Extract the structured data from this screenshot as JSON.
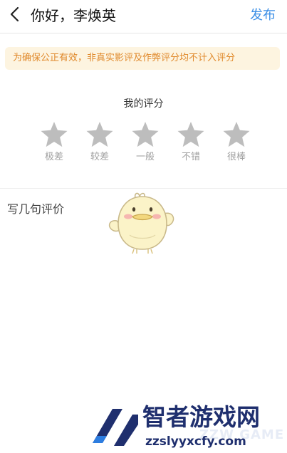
{
  "header": {
    "back_icon": "chevron-left-icon",
    "title": "你好，李焕英",
    "publish_label": "发布",
    "publish_color": "#3a8ee6"
  },
  "notice": {
    "text": "为确保公正有效，非真实影评及作弊评分均不计入评分",
    "text_color": "#e0892b",
    "background": "#fdf4e0"
  },
  "rating": {
    "title": "我的评分",
    "star_icon": "star-icon",
    "star_color": "#bdbdbd",
    "value": 0,
    "max": 5,
    "options": [
      {
        "label": "极差"
      },
      {
        "label": "较差"
      },
      {
        "label": "一般"
      },
      {
        "label": "不错"
      },
      {
        "label": "很棒"
      }
    ]
  },
  "comment": {
    "placeholder": "写几句评价",
    "mascot_icon": "chick-mascot-icon"
  },
  "divider_color": "#eeeeee",
  "watermark": {
    "name": "智者游戏网",
    "sub": "ZZW GAME",
    "url": "zzslyyxcfy.com",
    "logo_icon": "zz-logo-icon",
    "name_color": "#1f2f6e",
    "logo_color": "#1f2f6e",
    "accent_color": "#2d7de0"
  }
}
